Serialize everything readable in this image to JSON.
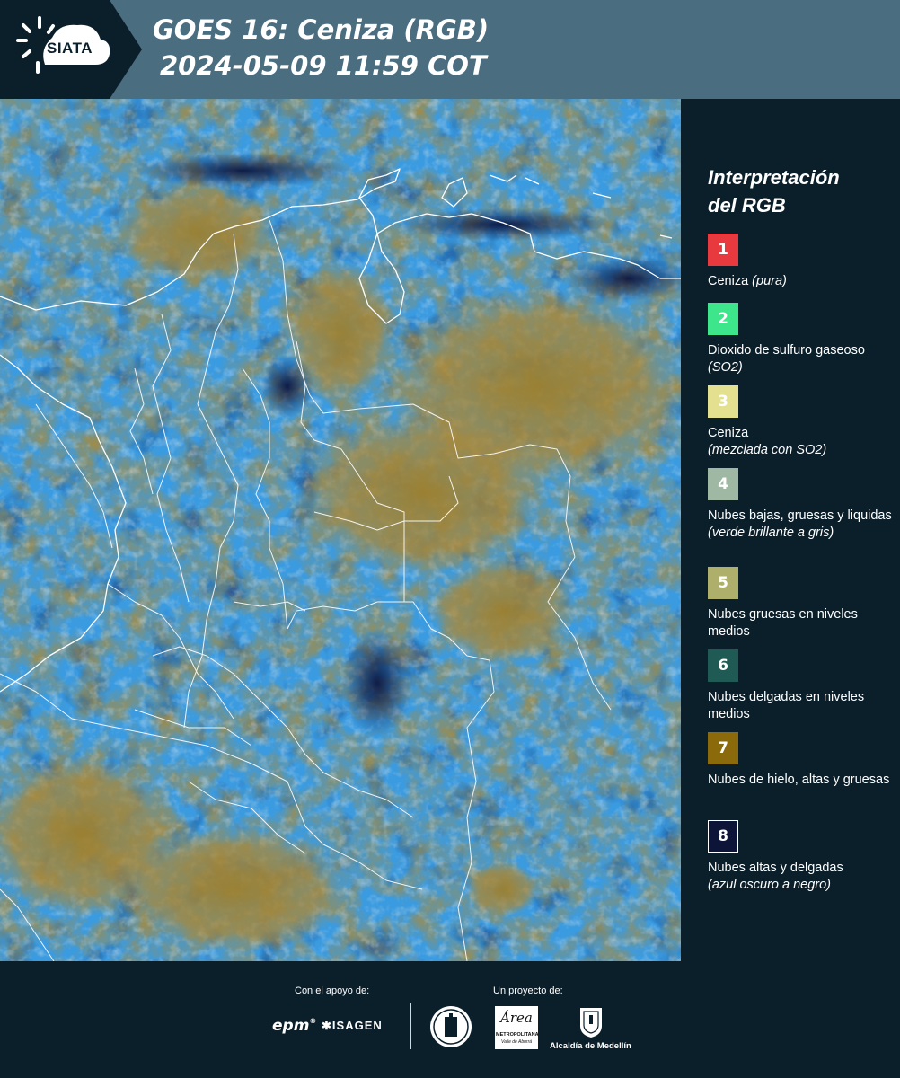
{
  "header": {
    "logo_text": "SIATA",
    "title_line1": "GOES 16: Ceniza (RGB)",
    "title_line2": "2024-05-09 11:59 COT"
  },
  "legend": {
    "title_line1": "Interpretación",
    "title_line2": "del RGB",
    "items": [
      {
        "number": "1",
        "color": "#e8393f",
        "text": "Ceniza",
        "note": "(pura)"
      },
      {
        "number": "2",
        "color": "#3de68a",
        "text": "Dioxido de sulfuro gaseoso",
        "note": "(SO2)"
      },
      {
        "number": "3",
        "color": "#e3e08f",
        "text": "Ceniza",
        "note": "(mezclada con SO2)"
      },
      {
        "number": "4",
        "color": "#9fb8a4",
        "text": "Nubes bajas, gruesas y liquidas",
        "note": "(verde brillante a gris)"
      },
      {
        "number": "5",
        "color": "#aeaf6a",
        "text": "Nubes gruesas en niveles medios",
        "note": ""
      },
      {
        "number": "6",
        "color": "#1f5a55",
        "text": "Nubes delgadas en niveles medios",
        "note": ""
      },
      {
        "number": "7",
        "color": "#8a6a0b",
        "text": "Nubes de hielo, altas y gruesas",
        "note": ""
      },
      {
        "number": "8",
        "color": "#0c1438",
        "text": "Nubes altas y delgadas",
        "note": "(azul oscuro a negro)"
      }
    ]
  },
  "footer": {
    "support_label": "Con el apoyo de:",
    "project_label": "Un proyecto de:",
    "partner_epm": "epm",
    "partner_isagen": "ISAGEN",
    "partner_area_line1": "Área",
    "partner_area_line2": "METROPOLITANA",
    "partner_area_line3": "Valle de Aburrá",
    "partner_alcaldia": "Alcaldía de Medellín"
  }
}
